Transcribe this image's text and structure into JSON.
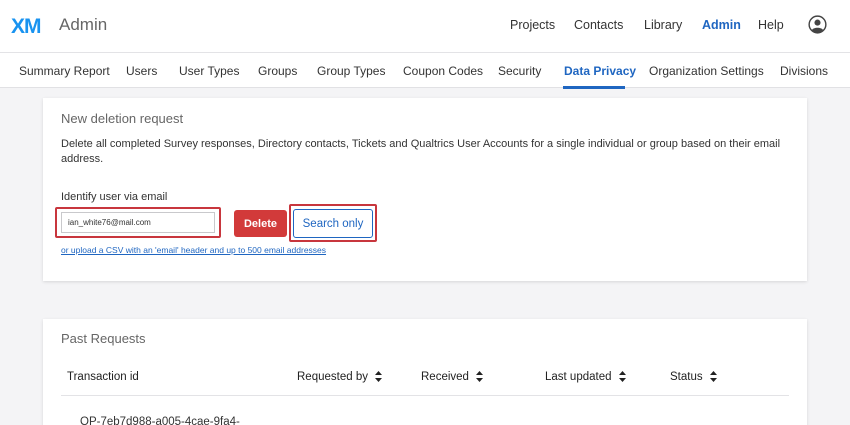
{
  "header": {
    "logo_text": "XM",
    "app_title": "Admin",
    "nav": [
      "Projects",
      "Contacts",
      "Library",
      "Admin",
      "Help"
    ],
    "active_nav": "Admin",
    "accent": "#1f66c1",
    "logo_color": "#1993f0"
  },
  "tabs": {
    "items": [
      "Summary Report",
      "Users",
      "User Types",
      "Groups",
      "Group Types",
      "Coupon Codes",
      "Security",
      "Data Privacy",
      "Organization Settings",
      "Divisions"
    ],
    "active": "Data Privacy"
  },
  "deletion": {
    "title": "New deletion request",
    "description": "Delete all completed Survey responses, Directory contacts, Tickets and Qualtrics User Accounts for a single individual or group based on their email address.",
    "email_label": "Identify user via email",
    "email_value": "ian_white76@mail.com",
    "delete_label": "Delete",
    "search_label": "Search only",
    "csv_link": "or upload a CSV with an 'email' header and up to 500 email addresses",
    "highlight_color": "#c8363d",
    "delete_color": "#d23a3a"
  },
  "past": {
    "title": "Past Requests",
    "columns": [
      "Transaction id",
      "Requested by",
      "Received",
      "Last updated",
      "Status"
    ],
    "rows": [
      {
        "transaction_id": "OP-7eb7d988-a005-4cae-9fa4-"
      }
    ]
  }
}
